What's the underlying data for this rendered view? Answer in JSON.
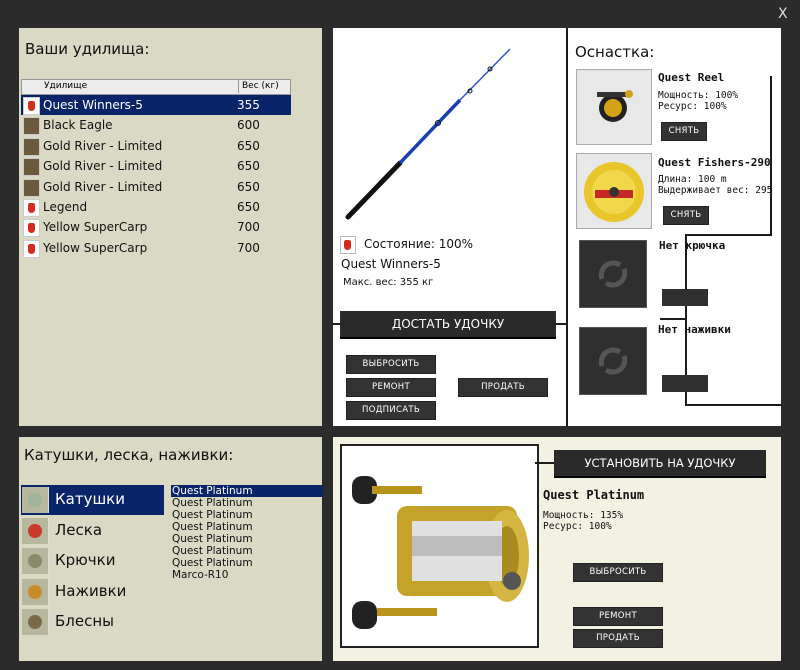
{
  "window": {
    "close_label": "X"
  },
  "rods_panel": {
    "title": "Ваши удилища:",
    "col_rod": "Удилище",
    "col_weight": "Вес (кг)",
    "rows": [
      {
        "name": "Quest Winners-5",
        "weight": "355",
        "icon": "red-float-icon",
        "selected": true
      },
      {
        "name": "Black Eagle",
        "weight": "600",
        "icon": "rod-icon"
      },
      {
        "name": "Gold River - Limited",
        "weight": "650",
        "icon": "rod-icon"
      },
      {
        "name": "Gold River - Limited",
        "weight": "650",
        "icon": "rod-icon"
      },
      {
        "name": "Gold River - Limited",
        "weight": "650",
        "icon": "rod-icon"
      },
      {
        "name": "Legend",
        "weight": "650",
        "icon": "red-float-icon"
      },
      {
        "name": "Yellow SuperCarp",
        "weight": "700",
        "icon": "red-float-icon"
      },
      {
        "name": "Yellow SuperCarp",
        "weight": "700",
        "icon": "red-float-icon"
      }
    ]
  },
  "rod_detail": {
    "condition": "Состояние: 100%",
    "name": "Quest Winners-5",
    "max_weight": "Макс. вес: 355 кг",
    "take_button": "ДОСТАТЬ УДОЧКУ",
    "throw_button": "ВЫБРОСИТЬ",
    "repair_button": "РЕМОНТ",
    "sell_button": "ПРОДАТЬ",
    "sign_button": "ПОДПИСАТЬ"
  },
  "tackle": {
    "title": "Оснастка:",
    "reel": {
      "name": "Quest Reel",
      "power": "Мощность: 100%",
      "resource": "Ресурс: 100%",
      "remove_button": "СНЯТЬ"
    },
    "line": {
      "name": "Quest Fishers-290",
      "length": "Длина: 100 m",
      "holds": "Выдерживает вес: 295",
      "remove_button": "СНЯТЬ"
    },
    "hook": {
      "label": "Нет крючка"
    },
    "bait": {
      "label": "Нет наживки"
    }
  },
  "inventory": {
    "title": "Катушки, леска, наживки:",
    "categories": [
      {
        "label": "Катушки",
        "icon": "reel-icon",
        "selected": true
      },
      {
        "label": "Леска",
        "icon": "line-spool-icon"
      },
      {
        "label": "Крючки",
        "icon": "hook-icon"
      },
      {
        "label": "Наживки",
        "icon": "bait-icon"
      },
      {
        "label": "Блесны",
        "icon": "lure-icon"
      }
    ],
    "items": [
      "Quest Platinum",
      "Quest Platinum",
      "Quest Platinum",
      "Quest Platinum",
      "Quest Platinum",
      "Quest Platinum",
      "Quest Platinum",
      "Marco-R10"
    ]
  },
  "item_detail": {
    "install_button": "УСТАНОВИТЬ НА УДОЧКУ",
    "name": "Quest Platinum",
    "power": "Мощность: 135%",
    "resource": "Ресурс: 100%",
    "throw_button": "ВЫБРОСИТЬ",
    "repair_button": "РЕМОНТ",
    "sell_button": "ПРОДАТЬ"
  }
}
